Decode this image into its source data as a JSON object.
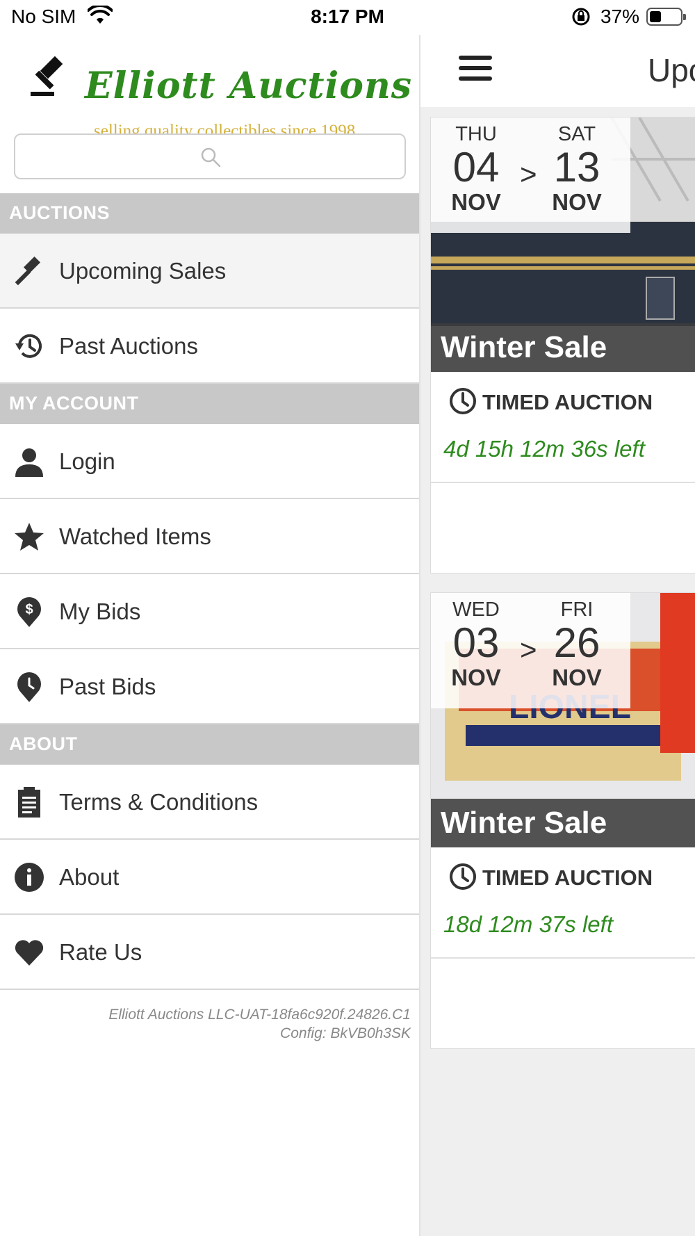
{
  "status_bar": {
    "carrier": "No SIM",
    "time": "8:17 PM",
    "battery_percent": "37%",
    "battery_level": 0.37
  },
  "drawer": {
    "brand_name": "Elliott Auctions",
    "tagline": "selling quality collectibles since 1998",
    "search": {
      "placeholder": ""
    },
    "sections": {
      "auctions": "AUCTIONS",
      "my_account": "MY ACCOUNT",
      "about": "ABOUT"
    },
    "items": {
      "upcoming_sales": "Upcoming Sales",
      "past_auctions": "Past Auctions",
      "login": "Login",
      "watched_items": "Watched Items",
      "my_bids": "My Bids",
      "past_bids": "Past Bids",
      "terms": "Terms & Conditions",
      "about": "About",
      "rate_us": "Rate Us"
    },
    "footer": {
      "version": "Elliott Auctions LLC-UAT-18fa6c920f.24826.C1",
      "config": "Config: BkVB0h3SK"
    }
  },
  "main": {
    "title": "Upc",
    "cards": [
      {
        "start_dow": "THU",
        "start_day": "04",
        "start_month": "NOV",
        "end_dow": "SAT",
        "end_day": "13",
        "end_month": "NOV",
        "arrow": ">",
        "sale_name": "Winter Sale",
        "auction_type": "TIMED AUCTION",
        "time_left": "4d 15h 12m 36s left"
      },
      {
        "start_dow": "WED",
        "start_day": "03",
        "start_month": "NOV",
        "end_dow": "FRI",
        "end_day": "26",
        "end_month": "NOV",
        "arrow": ">",
        "sale_name": "Winter Sale",
        "auction_type": "TIMED AUCTION",
        "time_left": "18d 12m 37s left"
      }
    ]
  },
  "colors": {
    "brand_green": "#2e8b1e",
    "tagline_gold": "#d4b13a",
    "section_header_bg": "#c8c8c8",
    "time_left_green": "#2e8b1e"
  }
}
